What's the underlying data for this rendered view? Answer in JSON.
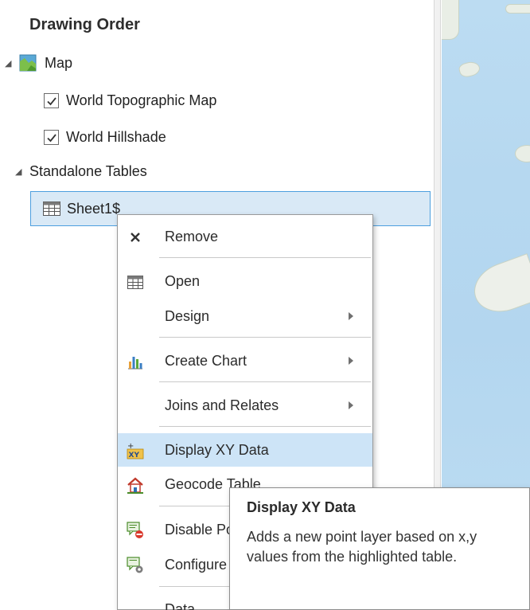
{
  "contents": {
    "title": "Drawing Order",
    "map_label": "Map",
    "layers": [
      {
        "label": "World Topographic Map",
        "checked": true
      },
      {
        "label": "World Hillshade",
        "checked": true
      }
    ],
    "standalone_label": "Standalone Tables",
    "table_label": "Sheet1$"
  },
  "context_menu": {
    "items": [
      {
        "label": "Remove",
        "icon": "close-icon",
        "submenu": false
      },
      {
        "label": "Open",
        "icon": "table-icon",
        "submenu": false
      },
      {
        "label": "Design",
        "icon": "",
        "submenu": true
      },
      {
        "label": "Create Chart",
        "icon": "chart-icon",
        "submenu": true
      },
      {
        "label": "Joins and Relates",
        "icon": "",
        "submenu": true
      },
      {
        "label": "Display XY Data",
        "icon": "xy-data-icon",
        "submenu": false
      },
      {
        "label": "Geocode Table",
        "icon": "geocode-icon",
        "submenu": false
      },
      {
        "label": "Disable Pop-ups",
        "icon": "disable-popup-icon",
        "submenu": false
      },
      {
        "label": "Configure Pop-ups",
        "icon": "configure-popup-icon",
        "submenu": false
      },
      {
        "label": "Data",
        "icon": "",
        "submenu": false
      }
    ],
    "highlighted": "Display XY Data"
  },
  "tooltip": {
    "title": "Display XY Data",
    "description": "Adds a new point layer based on x,y values from the highlighted table."
  },
  "colors": {
    "selection_fill": "#d9e9f6",
    "selection_border": "#4d9fde",
    "menu_highlight": "#cde4f7",
    "map_water": "#b6d8f0"
  }
}
